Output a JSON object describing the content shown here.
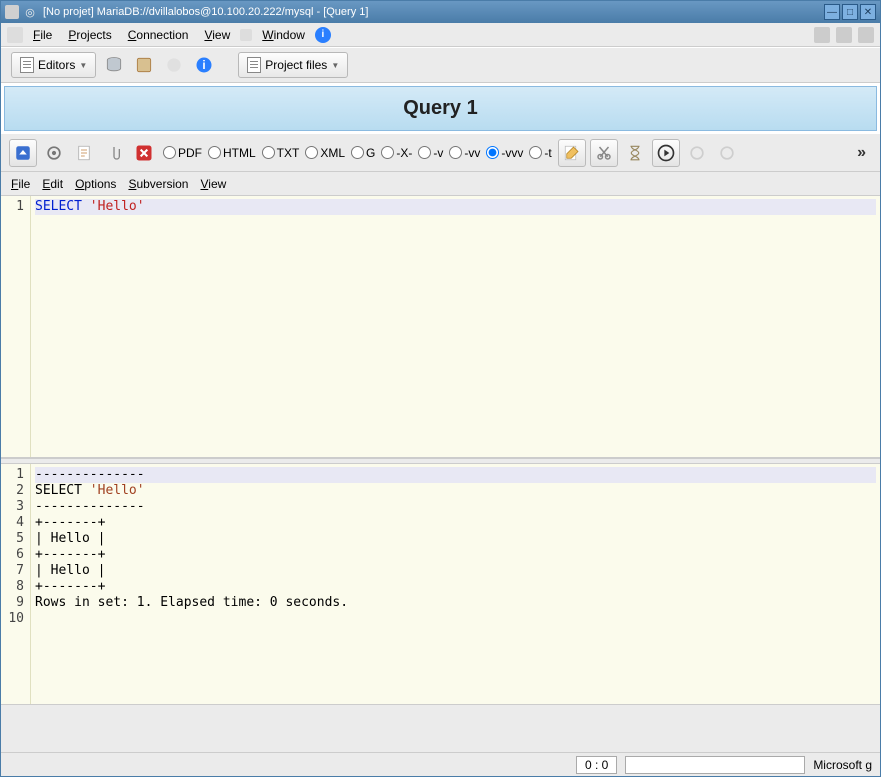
{
  "titlebar": {
    "text": "[No projet] MariaDB://dvillalobos@10.100.20.222/mysql - [Query 1]"
  },
  "menubar": {
    "file": "File",
    "projects": "Projects",
    "connection": "Connection",
    "view": "View",
    "window": "Window"
  },
  "toolbar1": {
    "editors": "Editors",
    "projectfiles": "Project files"
  },
  "tab": {
    "title": "Query 1"
  },
  "toolbar2": {
    "formats": [
      "PDF",
      "HTML",
      "TXT",
      "XML",
      "G",
      "-X-",
      "-v",
      "-vv",
      "-vvv",
      "-t"
    ],
    "selected": "-vvv"
  },
  "editor_menu": {
    "file": "File",
    "edit": "Edit",
    "options": "Options",
    "subversion": "Subversion",
    "view": "View"
  },
  "editor": {
    "lines": [
      {
        "n": 1,
        "tokens": [
          {
            "t": "SELECT",
            "c": "kw-select"
          },
          {
            "t": " ",
            "c": ""
          },
          {
            "t": "'Hello'",
            "c": "kw-string"
          }
        ],
        "hl": true
      }
    ]
  },
  "output": {
    "lines": [
      {
        "n": 1,
        "text": "--------------",
        "hl": true
      },
      {
        "n": 2,
        "tokens": [
          {
            "t": "SELECT ",
            "c": ""
          },
          {
            "t": "'Hello'",
            "c": "out-string"
          }
        ]
      },
      {
        "n": 3,
        "text": "--------------"
      },
      {
        "n": 4,
        "text": "+-------+"
      },
      {
        "n": 5,
        "text": "| Hello |"
      },
      {
        "n": 6,
        "text": "+-------+"
      },
      {
        "n": 7,
        "text": "| Hello |"
      },
      {
        "n": 8,
        "text": "+-------+"
      },
      {
        "n": 9,
        "text": "Rows in set: 1. Elapsed time: 0 seconds."
      },
      {
        "n": 10,
        "text": ""
      }
    ]
  },
  "statusbar": {
    "position": "0 : 0",
    "font": "Microsoft g"
  }
}
